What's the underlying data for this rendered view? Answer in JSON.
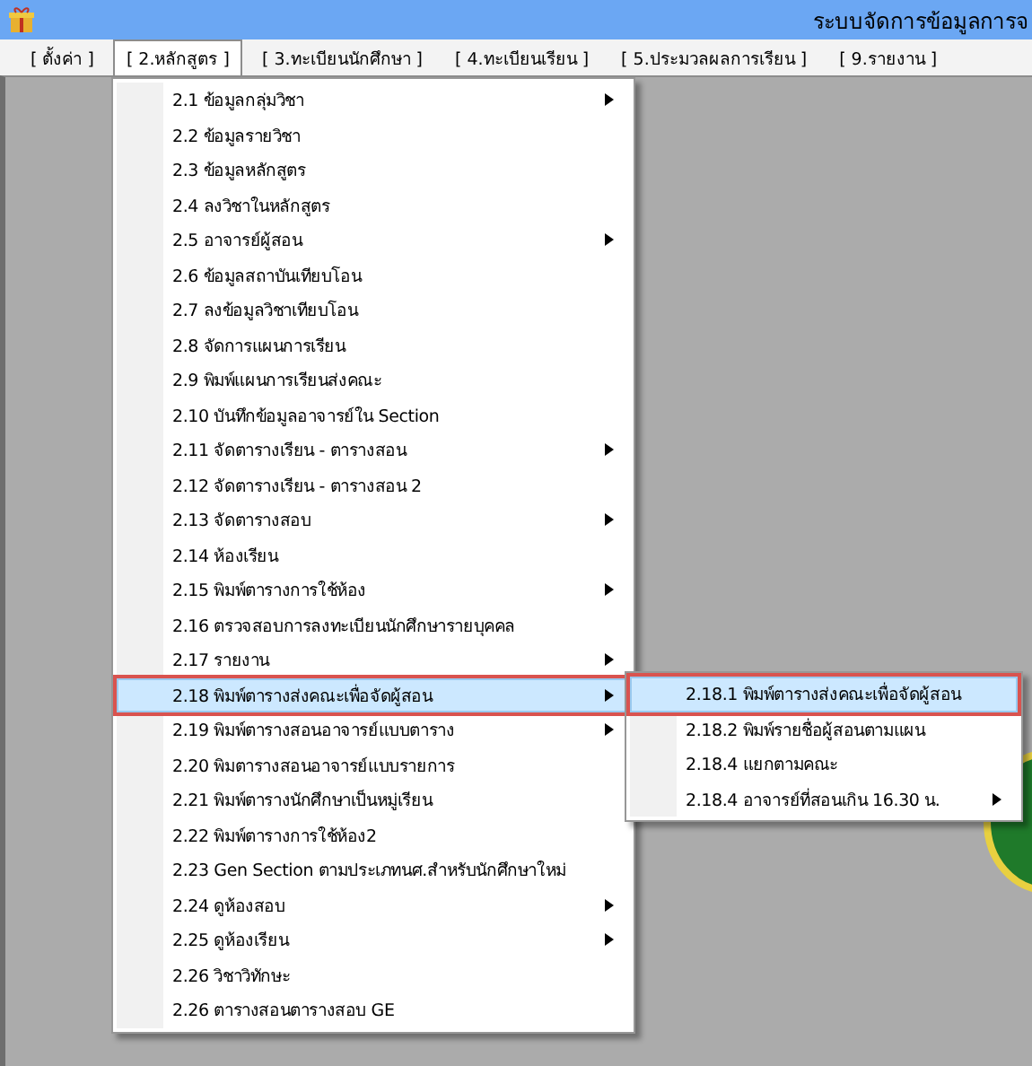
{
  "window": {
    "title": "ระบบจัดการข้อมูลการจ"
  },
  "menu_bar": [
    {
      "label": "[ ตั้งค่า ]",
      "selected": false
    },
    {
      "label": "[ 2.หลักสูตร ]",
      "selected": true
    },
    {
      "label": "[ 3.ทะเบียนนักศึกษา ]",
      "selected": false
    },
    {
      "label": "[ 4.ทะเบียนเรียน ]",
      "selected": false
    },
    {
      "label": "[ 5.ประมวลผลการเรียน ]",
      "selected": false
    },
    {
      "label": "[ 9.รายงาน ]",
      "selected": false
    }
  ],
  "menu": {
    "items": [
      {
        "label": "2.1 ข้อมูลกลุ่มวิชา",
        "has_submenu": true,
        "selected": false
      },
      {
        "label": "2.2 ข้อมูลรายวิชา",
        "has_submenu": false,
        "selected": false
      },
      {
        "label": "2.3 ข้อมูลหลักสูตร",
        "has_submenu": false,
        "selected": false
      },
      {
        "label": "2.4 ลงวิชาในหลักสูตร",
        "has_submenu": false,
        "selected": false
      },
      {
        "label": "2.5 อาจารย์ผู้สอน",
        "has_submenu": true,
        "selected": false
      },
      {
        "label": "2.6 ข้อมูลสถาบันเทียบโอน",
        "has_submenu": false,
        "selected": false
      },
      {
        "label": "2.7 ลงข้อมูลวิชาเทียบโอน",
        "has_submenu": false,
        "selected": false
      },
      {
        "label": "2.8 จัดการแผนการเรียน",
        "has_submenu": false,
        "selected": false
      },
      {
        "label": "2.9 พิมพ์แผนการเรียนส่งคณะ",
        "has_submenu": false,
        "selected": false
      },
      {
        "label": "2.10 บันทึกข้อมูลอาจารย์ใน Section",
        "has_submenu": false,
        "selected": false
      },
      {
        "label": "2.11 จัดตารางเรียน - ตารางสอน",
        "has_submenu": true,
        "selected": false
      },
      {
        "label": "2.12 จัดตารางเรียน - ตารางสอน 2",
        "has_submenu": false,
        "selected": false
      },
      {
        "label": "2.13 จัดตารางสอบ",
        "has_submenu": true,
        "selected": false
      },
      {
        "label": "2.14 ห้องเรียน",
        "has_submenu": false,
        "selected": false
      },
      {
        "label": "2.15 พิมพ์ตารางการใช้ห้อง",
        "has_submenu": true,
        "selected": false
      },
      {
        "label": "2.16 ตรวจสอบการลงทะเบียนนักศึกษารายบุคคล",
        "has_submenu": false,
        "selected": false
      },
      {
        "label": "2.17 รายงาน",
        "has_submenu": true,
        "selected": false
      },
      {
        "label": "2.18 พิมพ์ตารางส่งคณะเพื่อจัดผู้สอน",
        "has_submenu": true,
        "selected": true
      },
      {
        "label": "2.19 พิมพ์ตารางสอนอาจารย์แบบตาราง",
        "has_submenu": true,
        "selected": false
      },
      {
        "label": "2.20 พิมตารางสอนอาจารย์แบบรายการ",
        "has_submenu": false,
        "selected": false
      },
      {
        "label": "2.21 พิมพ์ตารางนักศึกษาเป็นหมู่เรียน",
        "has_submenu": false,
        "selected": false
      },
      {
        "label": "2.22 พิมพ์ตารางการใช้ห้อง2",
        "has_submenu": false,
        "selected": false
      },
      {
        "label": "2.23 Gen Section ตามประเภทนศ.สำหรับนักศึกษาใหม่",
        "has_submenu": false,
        "selected": false
      },
      {
        "label": "2.24 ดูห้องสอบ",
        "has_submenu": true,
        "selected": false
      },
      {
        "label": "2.25 ดูห้องเรียน",
        "has_submenu": true,
        "selected": false
      },
      {
        "label": "2.26 วิชาวิทักษะ",
        "has_submenu": false,
        "selected": false
      },
      {
        "label": "2.26 ตารางสอนตารางสอบ GE",
        "has_submenu": false,
        "selected": false
      }
    ]
  },
  "submenu": {
    "items": [
      {
        "label": "2.18.1 พิมพ์ตารางส่งคณะเพื่อจัดผู้สอน",
        "has_submenu": false,
        "selected": true
      },
      {
        "label": "2.18.2 พิมพ์รายชื่อผู้สอนตามแผน",
        "has_submenu": false,
        "selected": false
      },
      {
        "label": "2.18.4 แยกตามคณะ",
        "has_submenu": false,
        "selected": false
      },
      {
        "label": "2.18.4 อาจารย์ที่สอนเกิน 16.30 น.",
        "has_submenu": true,
        "selected": false
      }
    ]
  }
}
